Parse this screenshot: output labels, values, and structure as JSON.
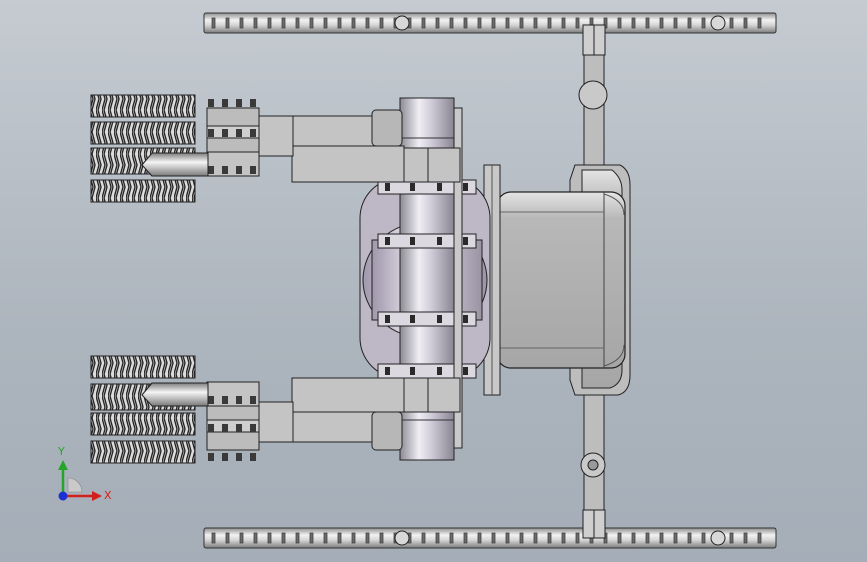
{
  "viewport": {
    "view": "top",
    "background_top": "#c5cbd1",
    "background_bottom": "#a5aeb8"
  },
  "triad": {
    "x_label": "X",
    "y_label": "Y",
    "x_color": "#d4201c",
    "y_color": "#26a52a",
    "z_color": "#1c2fd1"
  },
  "model": {
    "part_fill": "#b4b4b4",
    "edge_color": "#1a1a1a",
    "chrome_light": "#eeeeee",
    "chrome_dark": "#8c8c8c",
    "tread_dark": "#2b2b2b",
    "lavender": "#c7bdd0"
  }
}
